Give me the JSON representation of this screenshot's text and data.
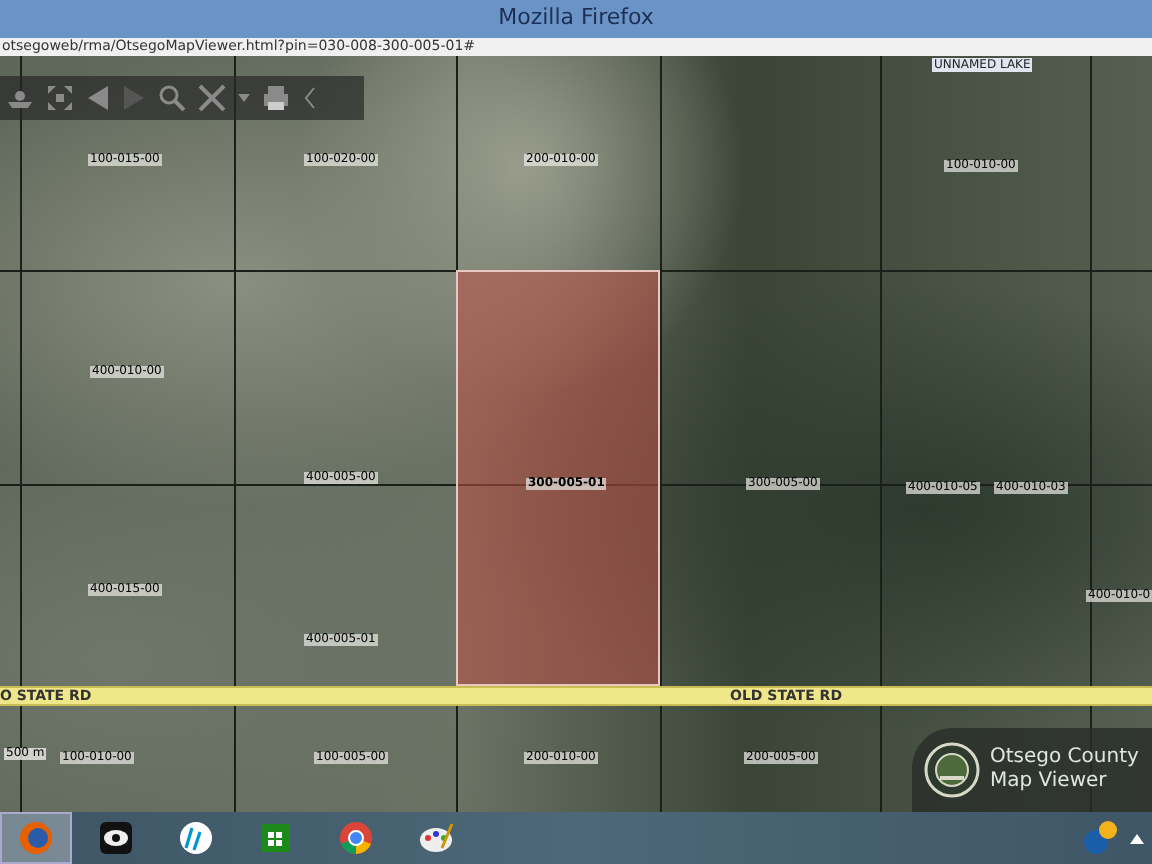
{
  "window": {
    "title": "Mozilla Firefox"
  },
  "address_bar": {
    "url": "otsegoweb/rma/OtsegoMapViewer.html?pin=030-008-300-005-01#"
  },
  "map": {
    "lake_label": "UNNAMED LAKE",
    "parcels": [
      {
        "label": "100-015-00",
        "selected": false
      },
      {
        "label": "100-020-00",
        "selected": false
      },
      {
        "label": "200-010-00",
        "selected": false
      },
      {
        "label": "100-010-00",
        "selected": false
      },
      {
        "label": "400-010-00",
        "selected": false
      },
      {
        "label": "400-005-00",
        "selected": false
      },
      {
        "label": "300-005-01",
        "selected": true
      },
      {
        "label": "300-005-00",
        "selected": false
      },
      {
        "label": "400-010-05",
        "selected": false
      },
      {
        "label": "400-010-03",
        "selected": false
      },
      {
        "label": "400-015-00",
        "selected": false
      },
      {
        "label": "400-005-01",
        "selected": false
      },
      {
        "label": "400-010-0",
        "selected": false
      },
      {
        "label": "100-010-00",
        "selected": false
      },
      {
        "label": "100-005-00",
        "selected": false
      },
      {
        "label": "200-010-00",
        "selected": false
      },
      {
        "label": "200-005-00",
        "selected": false
      }
    ],
    "roads": [
      "O STATE RD",
      "OLD STATE RD"
    ],
    "scale_label": "500 m",
    "logo": {
      "line1": "Otsego County",
      "line2": "Map Viewer"
    }
  },
  "taskbar": {
    "apps": [
      {
        "selected": true
      },
      {
        "selected": false
      },
      {
        "selected": false
      },
      {
        "selected": false
      },
      {
        "selected": false
      },
      {
        "selected": false
      }
    ]
  }
}
